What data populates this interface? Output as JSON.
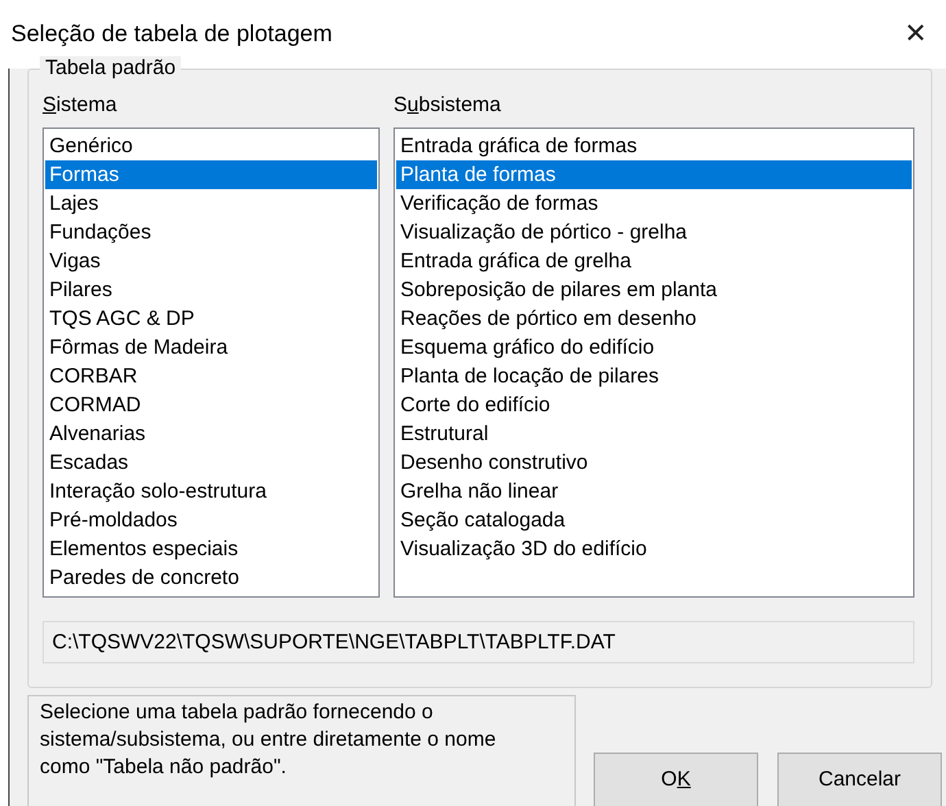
{
  "window": {
    "title": "Seleção de tabela de plotagem",
    "close_glyph": "✕"
  },
  "group": {
    "title": "Tabela padrão"
  },
  "sistema": {
    "label": {
      "key": "S",
      "after": "istema"
    },
    "items": [
      {
        "text": "Genérico",
        "selected": false
      },
      {
        "text": "Formas",
        "selected": true
      },
      {
        "text": "Lajes",
        "selected": false
      },
      {
        "text": "Fundações",
        "selected": false
      },
      {
        "text": "Vigas",
        "selected": false
      },
      {
        "text": "Pilares",
        "selected": false
      },
      {
        "text": "TQS AGC & DP",
        "selected": false
      },
      {
        "text": "Fôrmas de Madeira",
        "selected": false
      },
      {
        "text": "CORBAR",
        "selected": false
      },
      {
        "text": "CORMAD",
        "selected": false
      },
      {
        "text": "Alvenarias",
        "selected": false
      },
      {
        "text": "Escadas",
        "selected": false
      },
      {
        "text": "Interação solo-estrutura",
        "selected": false
      },
      {
        "text": "Pré-moldados",
        "selected": false
      },
      {
        "text": "Elementos especiais",
        "selected": false
      },
      {
        "text": "Paredes de concreto",
        "selected": false
      }
    ]
  },
  "subsistema": {
    "label": {
      "before": "S",
      "key": "u",
      "after": "bsistema"
    },
    "items": [
      {
        "text": "Entrada gráfica de formas",
        "selected": false
      },
      {
        "text": "Planta de formas",
        "selected": true
      },
      {
        "text": "Verificação de formas",
        "selected": false
      },
      {
        "text": "Visualização de pórtico - grelha",
        "selected": false
      },
      {
        "text": "Entrada gráfica de grelha",
        "selected": false
      },
      {
        "text": "Sobreposição de pilares em planta",
        "selected": false
      },
      {
        "text": "Reações de pórtico em desenho",
        "selected": false
      },
      {
        "text": "Esquema gráfico do edifício",
        "selected": false
      },
      {
        "text": "Planta de locação de pilares",
        "selected": false
      },
      {
        "text": "Corte do edifício",
        "selected": false
      },
      {
        "text": "Estrutural",
        "selected": false
      },
      {
        "text": "Desenho construtivo",
        "selected": false
      },
      {
        "text": "Grelha não linear",
        "selected": false
      },
      {
        "text": "Seção catalogada",
        "selected": false
      },
      {
        "text": "Visualização 3D do edifício",
        "selected": false
      }
    ]
  },
  "path": "C:\\TQSWV22\\TQSW\\SUPORTE\\NGE\\TABPLT\\TABPLTF.DAT",
  "help": "Selecione uma tabela padrão fornecendo o sistema/subsistema, ou entre diretamente o nome como \"Tabela não padrão\".",
  "buttons": [
    {
      "label": {
        "before": "O",
        "key": "K"
      }
    },
    {
      "label": {
        "after": "Cancelar"
      }
    }
  ]
}
